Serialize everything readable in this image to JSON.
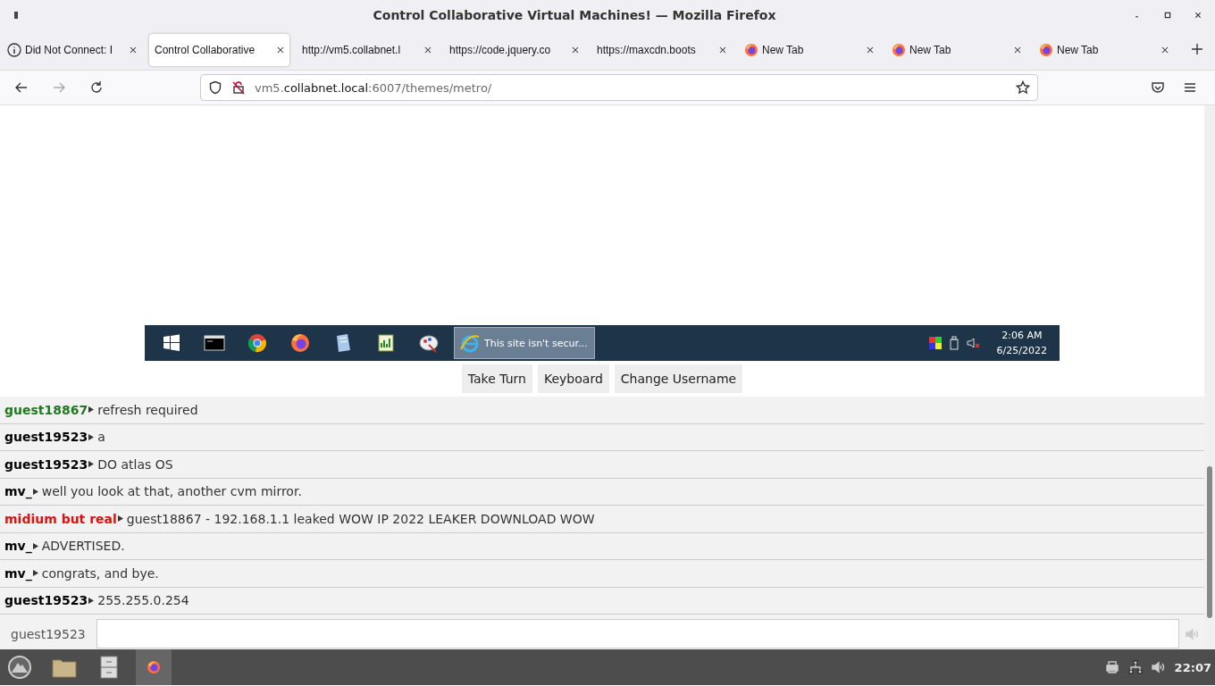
{
  "window": {
    "title": "Control Collaborative Virtual Machines! — Mozilla Firefox"
  },
  "tabs": [
    {
      "label": "Did Not Connect: I",
      "kind": "info",
      "selected": false
    },
    {
      "label": "Control Collaborative",
      "selected": true
    },
    {
      "label": "http://vm5.collabnet.l",
      "selected": false
    },
    {
      "label": "https://code.jquery.co",
      "selected": false
    },
    {
      "label": "https://maxcdn.boots",
      "selected": false
    },
    {
      "label": "New Tab",
      "kind": "firefox",
      "selected": false
    },
    {
      "label": "New Tab",
      "kind": "firefox",
      "selected": false
    },
    {
      "label": "New Tab",
      "kind": "firefox",
      "selected": false
    }
  ],
  "address": {
    "prefix": "vm5.",
    "domain": "collabnet.local",
    "path": ":6007/themes/metro/"
  },
  "vm_taskbar": {
    "apps": [
      {
        "kind": "start"
      },
      {
        "kind": "terminal"
      },
      {
        "kind": "chrome"
      },
      {
        "kind": "firefox"
      },
      {
        "kind": "notepad"
      },
      {
        "kind": "spreadsheet"
      },
      {
        "kind": "paint"
      }
    ],
    "task": {
      "label": "This site isn't secur..."
    },
    "time": "2:06 AM",
    "date": "6/25/2022"
  },
  "vm_buttons": [
    "Take Turn",
    "Keyboard",
    "Change Username"
  ],
  "chat": [
    {
      "user": "guest18867",
      "text": "refresh required",
      "color": "#1e7a1e"
    },
    {
      "user": "guest19523",
      "text": "a",
      "color": "#000000"
    },
    {
      "user": "guest19523",
      "text": "DO atlas OS",
      "color": "#000000"
    },
    {
      "user": "mv_",
      "text": "well you look at that, another cvm mirror.",
      "color": "#000000"
    },
    {
      "user": "midium but real",
      "text": "guest18867 - 192.168.1.1 leaked WOW IP 2022 LEAKER DOWNLOAD WOW",
      "color": "#dd1111"
    },
    {
      "user": "mv_",
      "text": "ADVERTISED.",
      "color": "#000000"
    },
    {
      "user": "mv_",
      "text": "congrats, and bye.",
      "color": "#000000"
    },
    {
      "user": "guest19523",
      "text": "255.255.0.254",
      "color": "#000000"
    }
  ],
  "chat_input": {
    "username": "guest19523"
  },
  "panel": {
    "clock": "22:07"
  }
}
